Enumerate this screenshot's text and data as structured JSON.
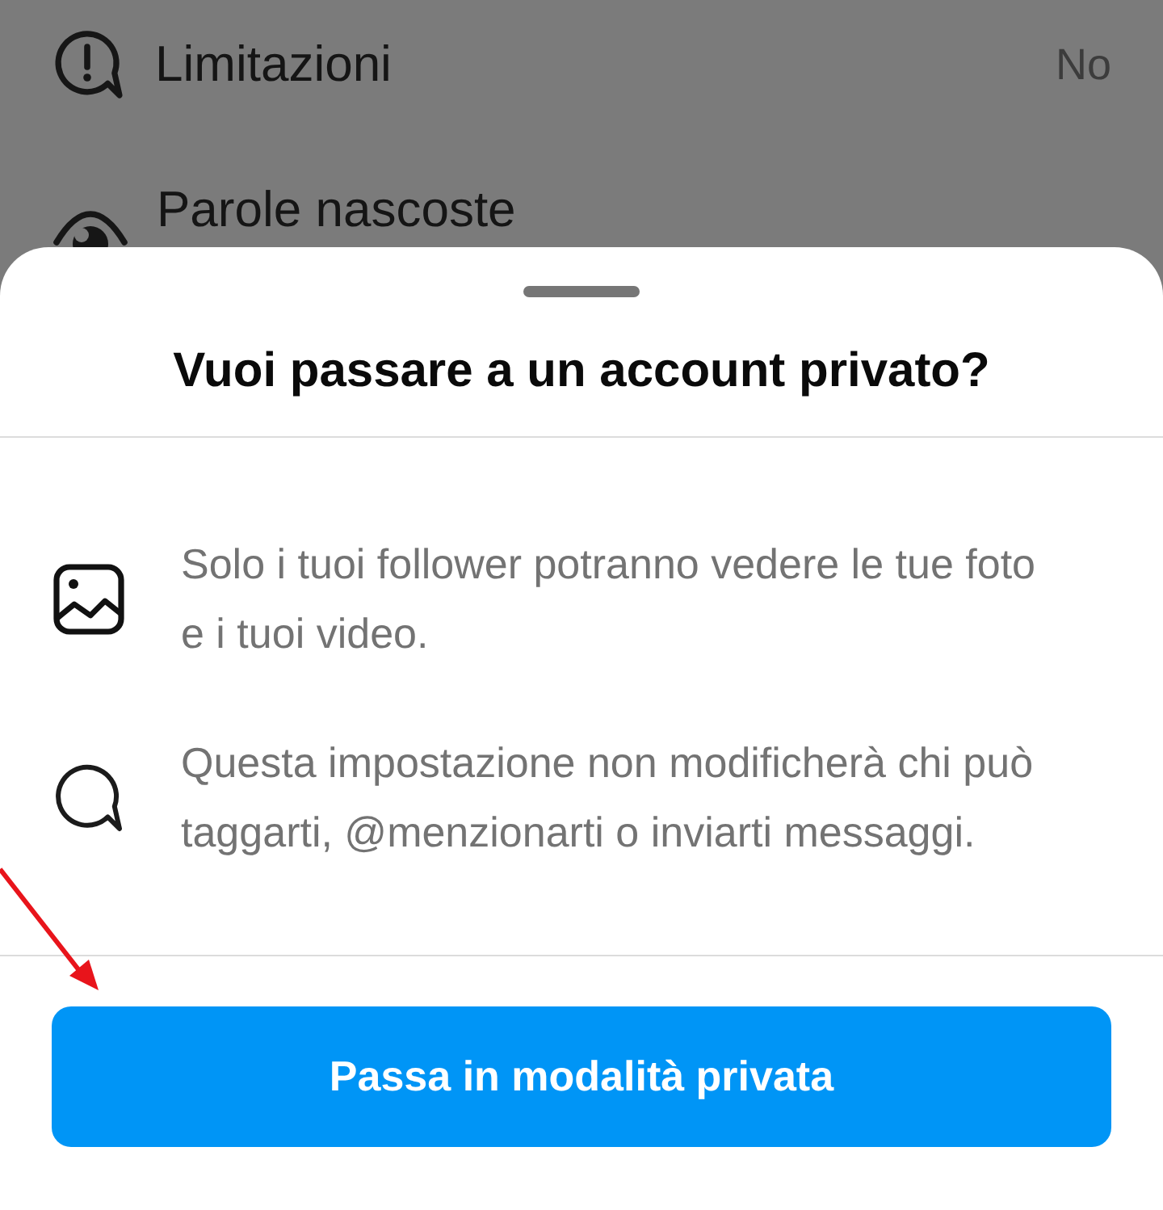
{
  "settings_rows": [
    {
      "kind": "alert",
      "label": "Limitazioni",
      "value": "No"
    },
    {
      "kind": "eye",
      "label": "Parole nascoste"
    }
  ],
  "sheet": {
    "title": "Vuoi passare a un account privato?",
    "items": [
      {
        "kind": "photo",
        "text": "Solo i tuoi follower potranno vedere le tue foto e i tuoi video."
      },
      {
        "kind": "chat",
        "text": "Questa impostazione non modificherà chi può taggarti, @menzionarti o inviarti messaggi."
      }
    ],
    "button": "Passa in modalità privata"
  }
}
